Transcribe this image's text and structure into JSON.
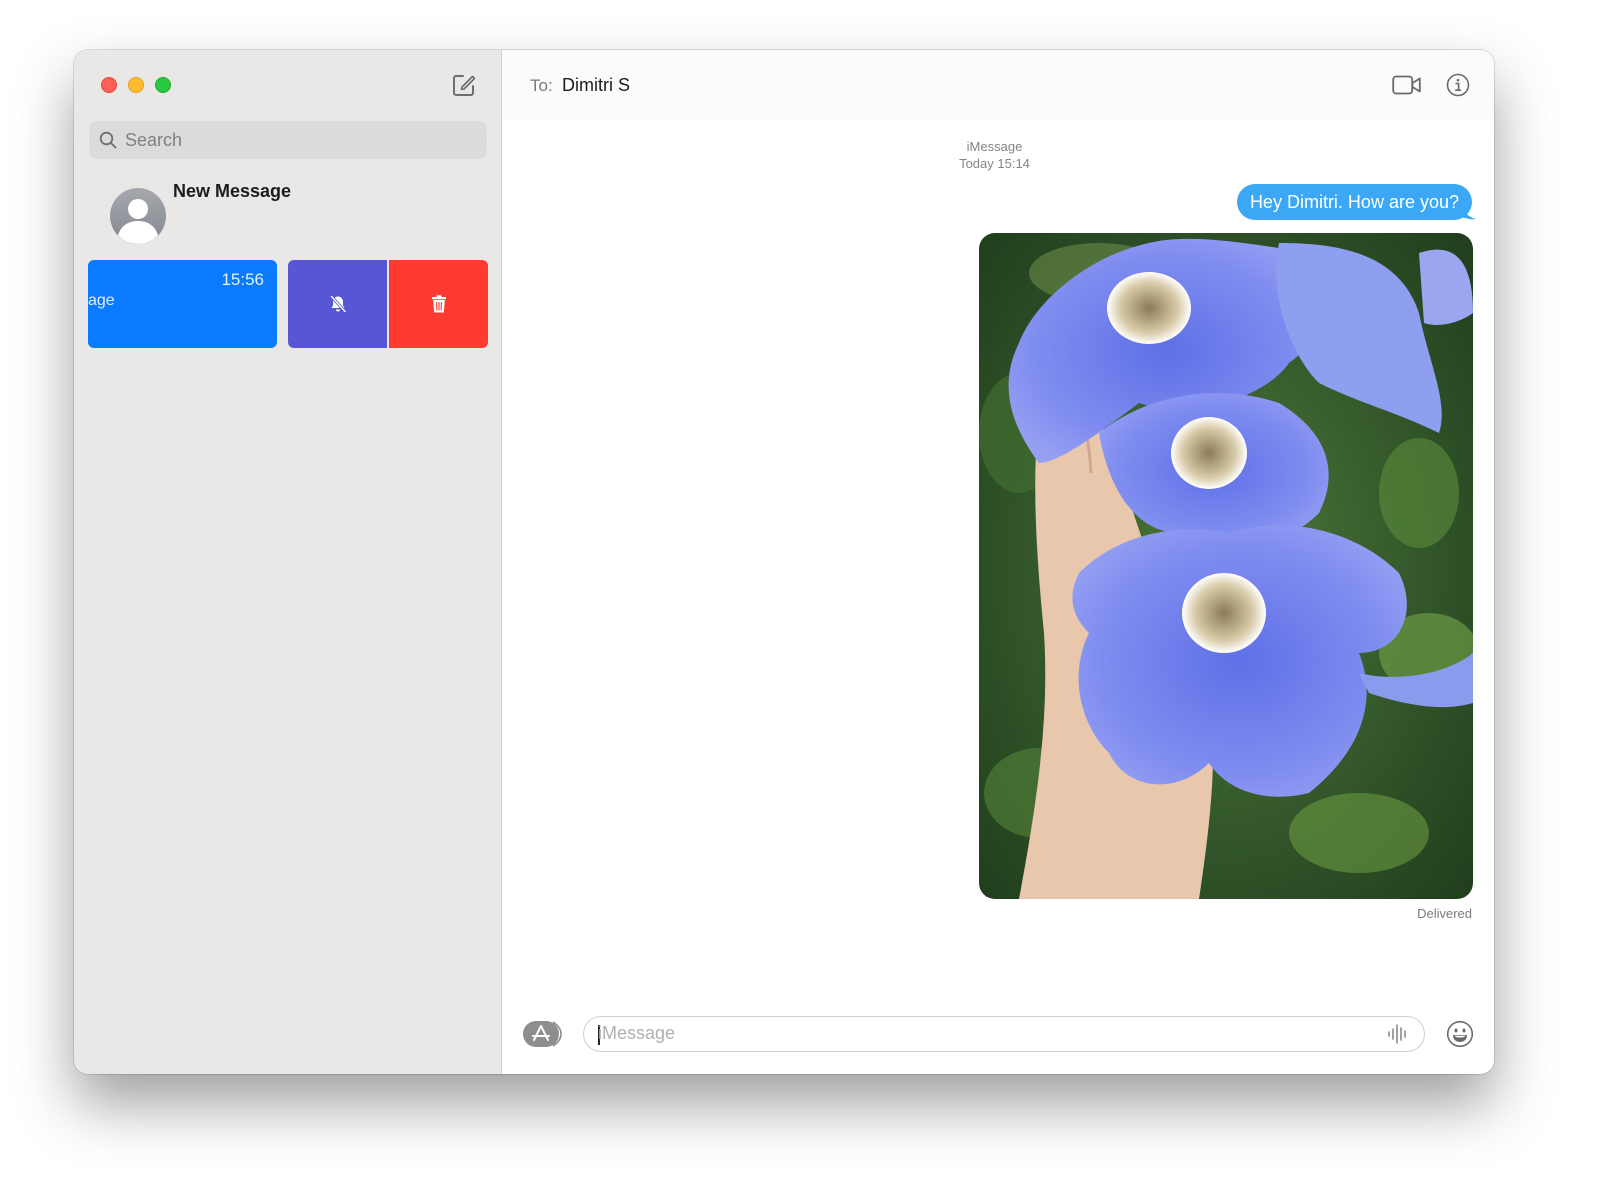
{
  "window": {
    "traffic_lights": [
      "close",
      "minimize",
      "maximize"
    ]
  },
  "sidebar": {
    "compose_icon": "compose-icon",
    "search": {
      "placeholder": "Search",
      "value": ""
    },
    "new_message": {
      "title": "New Message",
      "avatar_icon": "person-placeholder-icon"
    },
    "swiped_conversation": {
      "time": "15:56",
      "preview_fragment": "age",
      "actions": [
        {
          "name": "mute",
          "icon": "bell-slash-icon",
          "color": "#5856d5"
        },
        {
          "name": "delete",
          "icon": "trash-icon",
          "color": "#ff3a30"
        }
      ],
      "highlight_color": "#0a7aff"
    }
  },
  "conversation": {
    "header": {
      "to_label": "To:",
      "recipient": "Dimitri S",
      "video_icon": "video-camera-icon",
      "info_icon": "info-icon"
    },
    "service": "iMessage",
    "timestamp": "Today 15:14",
    "messages": [
      {
        "type": "text",
        "from": "me",
        "text": "Hey Dimitri. How are you?",
        "color": "#3ca8f5"
      },
      {
        "type": "image",
        "from": "me",
        "description": "Hand holding blue thunbergia flowers against green foliage"
      }
    ],
    "status": "Delivered"
  },
  "composer": {
    "apps_icon": "app-store-icon",
    "placeholder": "iMessage",
    "value": "",
    "audio_icon": "waveform-icon",
    "emoji_icon": "emoji-icon"
  }
}
